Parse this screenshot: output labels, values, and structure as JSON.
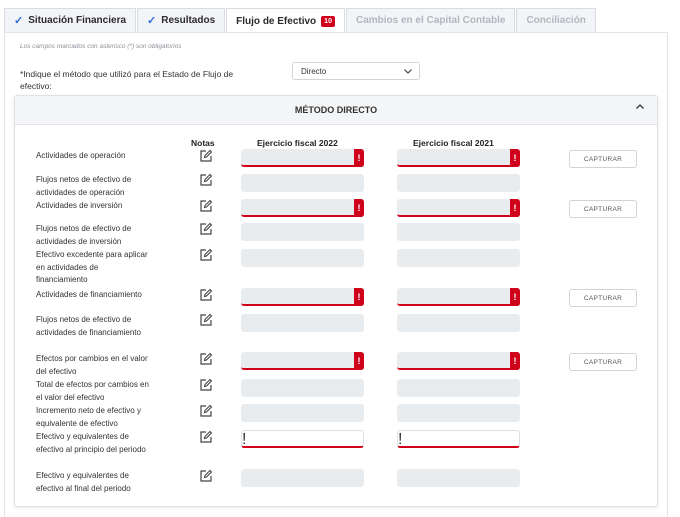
{
  "tabs": [
    {
      "label": "Situación Financiera",
      "check": "✓"
    },
    {
      "label": "Resultados",
      "check": "✓"
    },
    {
      "label": "Flujo de Efectivo",
      "badge": "10"
    },
    {
      "label": "Cambios en el Capital Contable"
    },
    {
      "label": "Conciliación"
    }
  ],
  "form": {
    "required_note": "Los campos marcados con asterisco (*) son obligatorios",
    "method_label": "*Indique el método que utilizó para el Estado de Flujo de efectivo:",
    "method_value": "Directo"
  },
  "section": {
    "title": "MÉTODO DIRECTO",
    "col_notas": "Notas",
    "col_2022": "Ejercicio fiscal 2022",
    "col_2021": "Ejercicio fiscal 2021",
    "capture_label": "CAPTURAR",
    "error_mark": "!",
    "rows": [
      {
        "label": "Actividades de operación"
      },
      {
        "label": "Flujos netos de efectivo de actividades de operación"
      },
      {
        "label": "Actividades de inversión"
      },
      {
        "label": "Flujos netos de efectivo de actividades de inversión"
      },
      {
        "label": "Efectivo excedente para aplicar en actividades de financiamiento"
      },
      {
        "label": "Actividades de financiamiento"
      },
      {
        "label": "Flujos netos de efectivo de actividades de financiamiento"
      },
      {
        "label": "Efectos por cambios en el valor del efectivo"
      },
      {
        "label": "Total de efectos por cambios en el valor del efectivo"
      },
      {
        "label": "Incremento neto de efectivo y equivalente de efectivo"
      },
      {
        "label": "Efectivo y equivalentes de efectivo al principio del periodo"
      },
      {
        "label": "Efectivo y equivalentes de efectivo al final del periodo"
      }
    ]
  },
  "colors": {
    "accent": "#2a6fd6",
    "error": "#d0021b"
  }
}
